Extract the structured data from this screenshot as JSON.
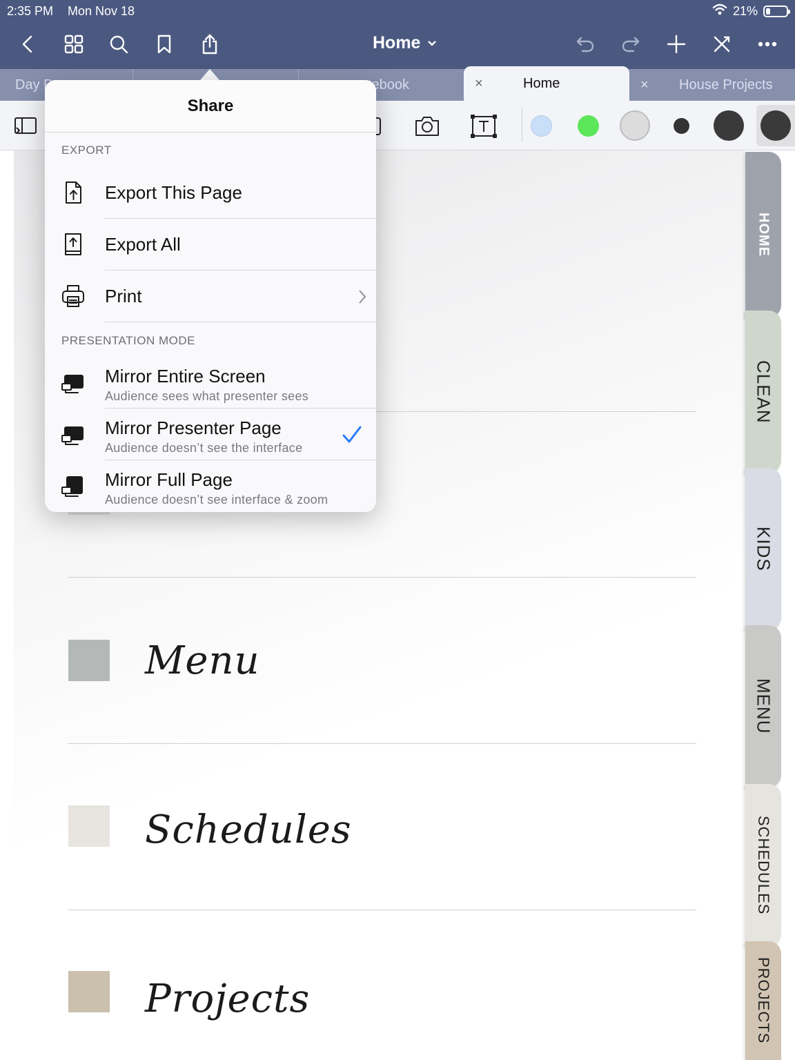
{
  "status": {
    "time": "2:35 PM",
    "date": "Mon Nov 18",
    "battery_text": "21%",
    "battery_level": 0.21
  },
  "nav": {
    "title": "Home"
  },
  "tabs": [
    {
      "label": "Day P",
      "active": false
    },
    {
      "label": "",
      "active": false
    },
    {
      "label": "tebook",
      "active": false
    },
    {
      "label": "Home",
      "active": true,
      "close": "×"
    },
    {
      "label": "House Projects",
      "active": false,
      "close": "×"
    }
  ],
  "colors": {
    "nav_bg": "#4b5980",
    "tab_bg": "#8690ad",
    "accent_check": "#2a7cf6",
    "swatches": [
      "#c9def8",
      "#5ce65a",
      "#dcdcdc",
      "#333333",
      "#3a3a3a",
      "#3a3a3a"
    ]
  },
  "share": {
    "title": "Share",
    "export_header": "EXPORT",
    "export_items": [
      {
        "title": "Export This Page",
        "icon": "export-page-icon"
      },
      {
        "title": "Export All",
        "icon": "export-all-icon"
      },
      {
        "title": "Print",
        "icon": "printer-icon"
      }
    ],
    "presentation_header": "PRESENTATION MODE",
    "presentation_items": [
      {
        "title": "Mirror Entire Screen",
        "subtitle": "Audience sees what presenter sees",
        "selected": false
      },
      {
        "title": "Mirror Presenter Page",
        "subtitle": "Audience doesn’t see the interface",
        "selected": true
      },
      {
        "title": "Mirror Full Page",
        "subtitle": "Audience doesn’t see interface & zoom",
        "selected": false
      }
    ]
  },
  "sections": [
    {
      "label": "Menu",
      "color": "#b4b8b6"
    },
    {
      "label": "Schedules",
      "color": "#e8e5e0"
    },
    {
      "label": "Projects",
      "color": "#cbbfae"
    }
  ],
  "side_tabs": [
    {
      "label": "HOME",
      "color": "#9ea3ab"
    },
    {
      "label": "CLEAN",
      "color": "#cfd6cc"
    },
    {
      "label": "KIDS",
      "color": "#d9dce4"
    },
    {
      "label": "MENU",
      "color": "#c9c9c7"
    },
    {
      "label": "SCHEDULES",
      "color": "#e6e4df"
    },
    {
      "label": "PROJECTS",
      "color": "#d1c4b2"
    }
  ]
}
